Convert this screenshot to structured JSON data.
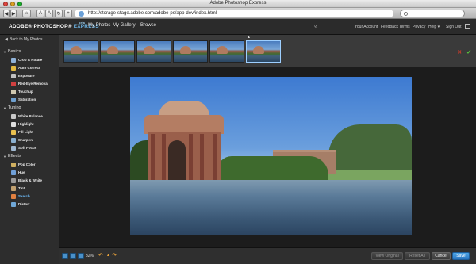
{
  "window": {
    "title": "Adobe Photoshop Express"
  },
  "browser": {
    "url": "http://storage-stage.adobe.com/adobe-ps/app-dev/index.html",
    "buttons": [
      "◀",
      "▶",
      "⌂",
      "A",
      "A",
      "↻",
      "+"
    ],
    "search_placeholder": ""
  },
  "header": {
    "logo_main": "ADOBE® PHOTOSHOP®",
    "logo_express": "EXPRESS",
    "logo_beta": "beta",
    "nav": [
      "My Photos",
      "My Gallery",
      "Browse"
    ],
    "center_mark": "½",
    "links": [
      "Your Account",
      "Feedback",
      "Terms",
      "Privacy",
      "Help ▾",
      "Sign Out"
    ]
  },
  "sidebar": {
    "back_label": "Back to My Photos",
    "sections": [
      {
        "title": "Basics",
        "tools": [
          {
            "label": "Crop & Rotate",
            "color": "#8fb2d8"
          },
          {
            "label": "Auto Correct",
            "color": "#e2b940"
          },
          {
            "label": "Exposure",
            "color": "#c0c0c0"
          },
          {
            "label": "Red-Eye Removal",
            "color": "#d04040"
          },
          {
            "label": "Touchup",
            "color": "#d0c8b0"
          },
          {
            "label": "Saturation",
            "color": "#6ea0d0"
          }
        ]
      },
      {
        "title": "Tuning",
        "tools": [
          {
            "label": "White Balance",
            "color": "#c8c8c8"
          },
          {
            "label": "Highlight",
            "color": "#e0e0e0"
          },
          {
            "label": "Fill Light",
            "color": "#e8c050"
          },
          {
            "label": "Sharpen",
            "color": "#8ab0d0"
          },
          {
            "label": "Soft Focus",
            "color": "#a0b8d0"
          }
        ]
      },
      {
        "title": "Effects",
        "tools": [
          {
            "label": "Pop Color",
            "color": "#d0b060"
          },
          {
            "label": "Hue",
            "color": "#70a0d8"
          },
          {
            "label": "Black & White",
            "color": "#9a9a9a"
          },
          {
            "label": "Tint",
            "color": "#c0a070"
          },
          {
            "label": "Sketch",
            "color": "#e08040",
            "active": true
          },
          {
            "label": "Distort",
            "color": "#70a8d8"
          }
        ]
      }
    ]
  },
  "filmstrip": {
    "thumbnails": 6,
    "selected_index": 5,
    "collapse_arrow": "▲"
  },
  "toolbar_actions": {
    "cancel_glyph": "✕",
    "apply_glyph": "✔"
  },
  "bottom": {
    "zoom": "32%",
    "undo": "↶",
    "redo": "↷",
    "view_original": "View Original",
    "reset_all": "Reset All",
    "cancel": "Cancel",
    "save": "Save"
  },
  "colors": {
    "accent": "#6fb7e8",
    "active_tool": "#6fc0ff",
    "save": "#2a75bf"
  }
}
